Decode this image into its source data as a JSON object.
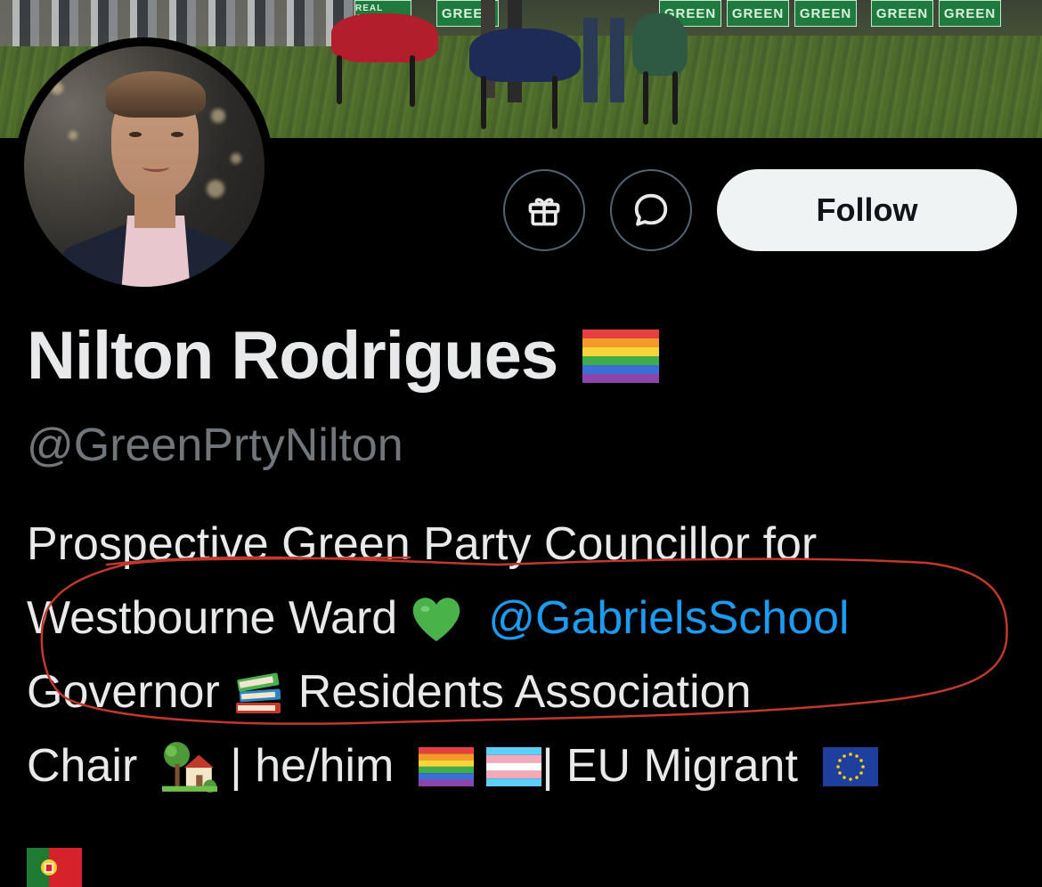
{
  "banner": {
    "signs": [
      "REAL CHANGE",
      "GREEN",
      "GREEN",
      "GREEN",
      "GREEN",
      "GREEN",
      "GREEN"
    ]
  },
  "actions": {
    "follow_label": "Follow",
    "gift_icon": "gift-icon",
    "message_icon": "message-bubble-icon"
  },
  "profile": {
    "display_name": "Nilton Rodrigues",
    "handle": "@GreenPrtyNilton"
  },
  "bio": {
    "line1": "Prospective Green Party Councillor for",
    "line2_text": "Westbourne Ward",
    "line2_emoji": "💚",
    "mention": "@GabrielsSchool",
    "line3_text": "Governor",
    "line3_after": "Residents Association",
    "line4_text": "Chair",
    "line4_mid": "| he/him",
    "line4_sep": "|",
    "line4_after": "EU Migrant"
  },
  "colors": {
    "background": "#000000",
    "primary_text": "#e7e9ea",
    "secondary_text": "#71767b",
    "mention": "#1d9bf0",
    "follow_bg": "#eff3f4",
    "annotation": "#c0392b"
  }
}
